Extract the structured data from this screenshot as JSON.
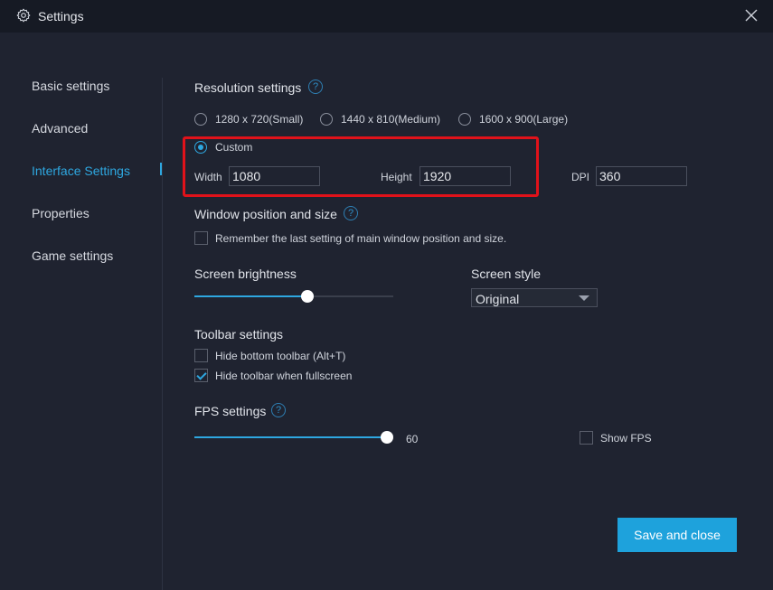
{
  "window": {
    "title": "Settings"
  },
  "sidebar": {
    "items": [
      {
        "label": "Basic settings"
      },
      {
        "label": "Advanced"
      },
      {
        "label": "Interface Settings",
        "active": true
      },
      {
        "label": "Properties"
      },
      {
        "label": "Game settings"
      }
    ]
  },
  "resolution": {
    "title": "Resolution settings",
    "options": [
      {
        "label": "1280 x 720(Small)",
        "checked": false
      },
      {
        "label": "1440 x 810(Medium)",
        "checked": false
      },
      {
        "label": "1600 x 900(Large)",
        "checked": false
      },
      {
        "label": "Custom",
        "checked": true
      }
    ],
    "width_label": "Width",
    "width_value": "1080",
    "height_label": "Height",
    "height_value": "1920",
    "dpi_label": "DPI",
    "dpi_value": "360"
  },
  "window_position": {
    "title": "Window position and size",
    "remember_label": "Remember the last setting of main window position and size.",
    "remember_checked": false
  },
  "brightness": {
    "title": "Screen brightness",
    "level": 0.57
  },
  "screen_style": {
    "title": "Screen style",
    "selected": "Original"
  },
  "toolbar": {
    "title": "Toolbar settings",
    "hide_bottom_label": "Hide bottom toolbar (Alt+T)",
    "hide_bottom_checked": false,
    "hide_fullscreen_label": "Hide toolbar when fullscreen",
    "hide_fullscreen_checked": true
  },
  "fps": {
    "title": "FPS settings",
    "value": "60",
    "level": 1.0,
    "show_fps_label": "Show FPS",
    "show_fps_checked": false
  },
  "footer": {
    "save_label": "Save and close"
  },
  "colors": {
    "accent": "#1ea2dc",
    "highlight": "#e0121a",
    "background": "#1f2330"
  }
}
